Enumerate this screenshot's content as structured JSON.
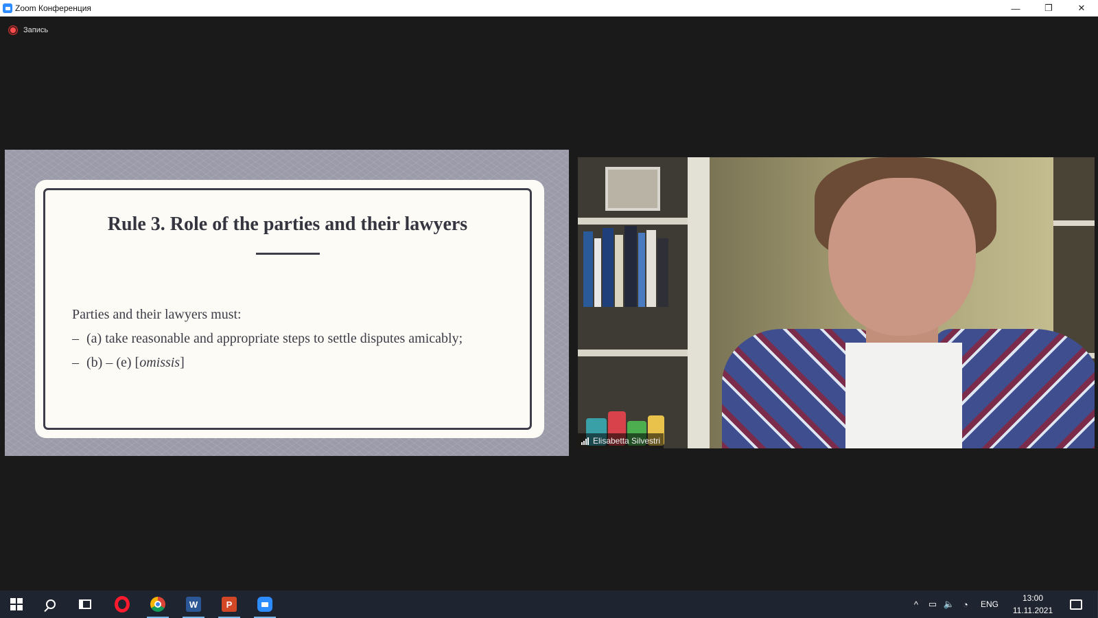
{
  "window": {
    "title": "Zoom Конференция",
    "controls": {
      "minimize": "—",
      "restore": "❐",
      "close": "✕"
    }
  },
  "recording": {
    "label": "Запись"
  },
  "slide": {
    "title": "Rule 3. Role of the parties and their lawyers",
    "intro": "Parties and their lawyers must:",
    "bullets": [
      {
        "dash": "–",
        "text": "(a) take reasonable and appropriate steps to settle disputes amicably;"
      },
      {
        "dash": "–",
        "text_before": "(b) – (e) [",
        "text_italic": "omissis",
        "text_after": "]"
      }
    ]
  },
  "participant": {
    "name": "Elisabetta Silvestri"
  },
  "taskbar": {
    "apps": [
      {
        "name": "start",
        "icon": "windows-icon"
      },
      {
        "name": "search",
        "icon": "search-icon"
      },
      {
        "name": "task-view",
        "icon": "task-view-icon"
      },
      {
        "name": "opera",
        "icon": "opera-icon"
      },
      {
        "name": "chrome",
        "icon": "chrome-icon",
        "active": true
      },
      {
        "name": "word",
        "icon": "word-icon",
        "label": "W",
        "active": true
      },
      {
        "name": "powerpoint",
        "icon": "powerpoint-icon",
        "label": "P",
        "active": true
      },
      {
        "name": "zoom",
        "icon": "zoom-icon",
        "active": true
      }
    ],
    "tray": {
      "chevron": "^",
      "language": "ENG",
      "time": "13:00",
      "date": "11.11.2021"
    }
  },
  "colors": {
    "accent_blue": "#2d8cff",
    "recording_red": "#ff4d4d",
    "taskbar_bg": "#1f2530",
    "meeting_bg": "#1a1a1a"
  }
}
